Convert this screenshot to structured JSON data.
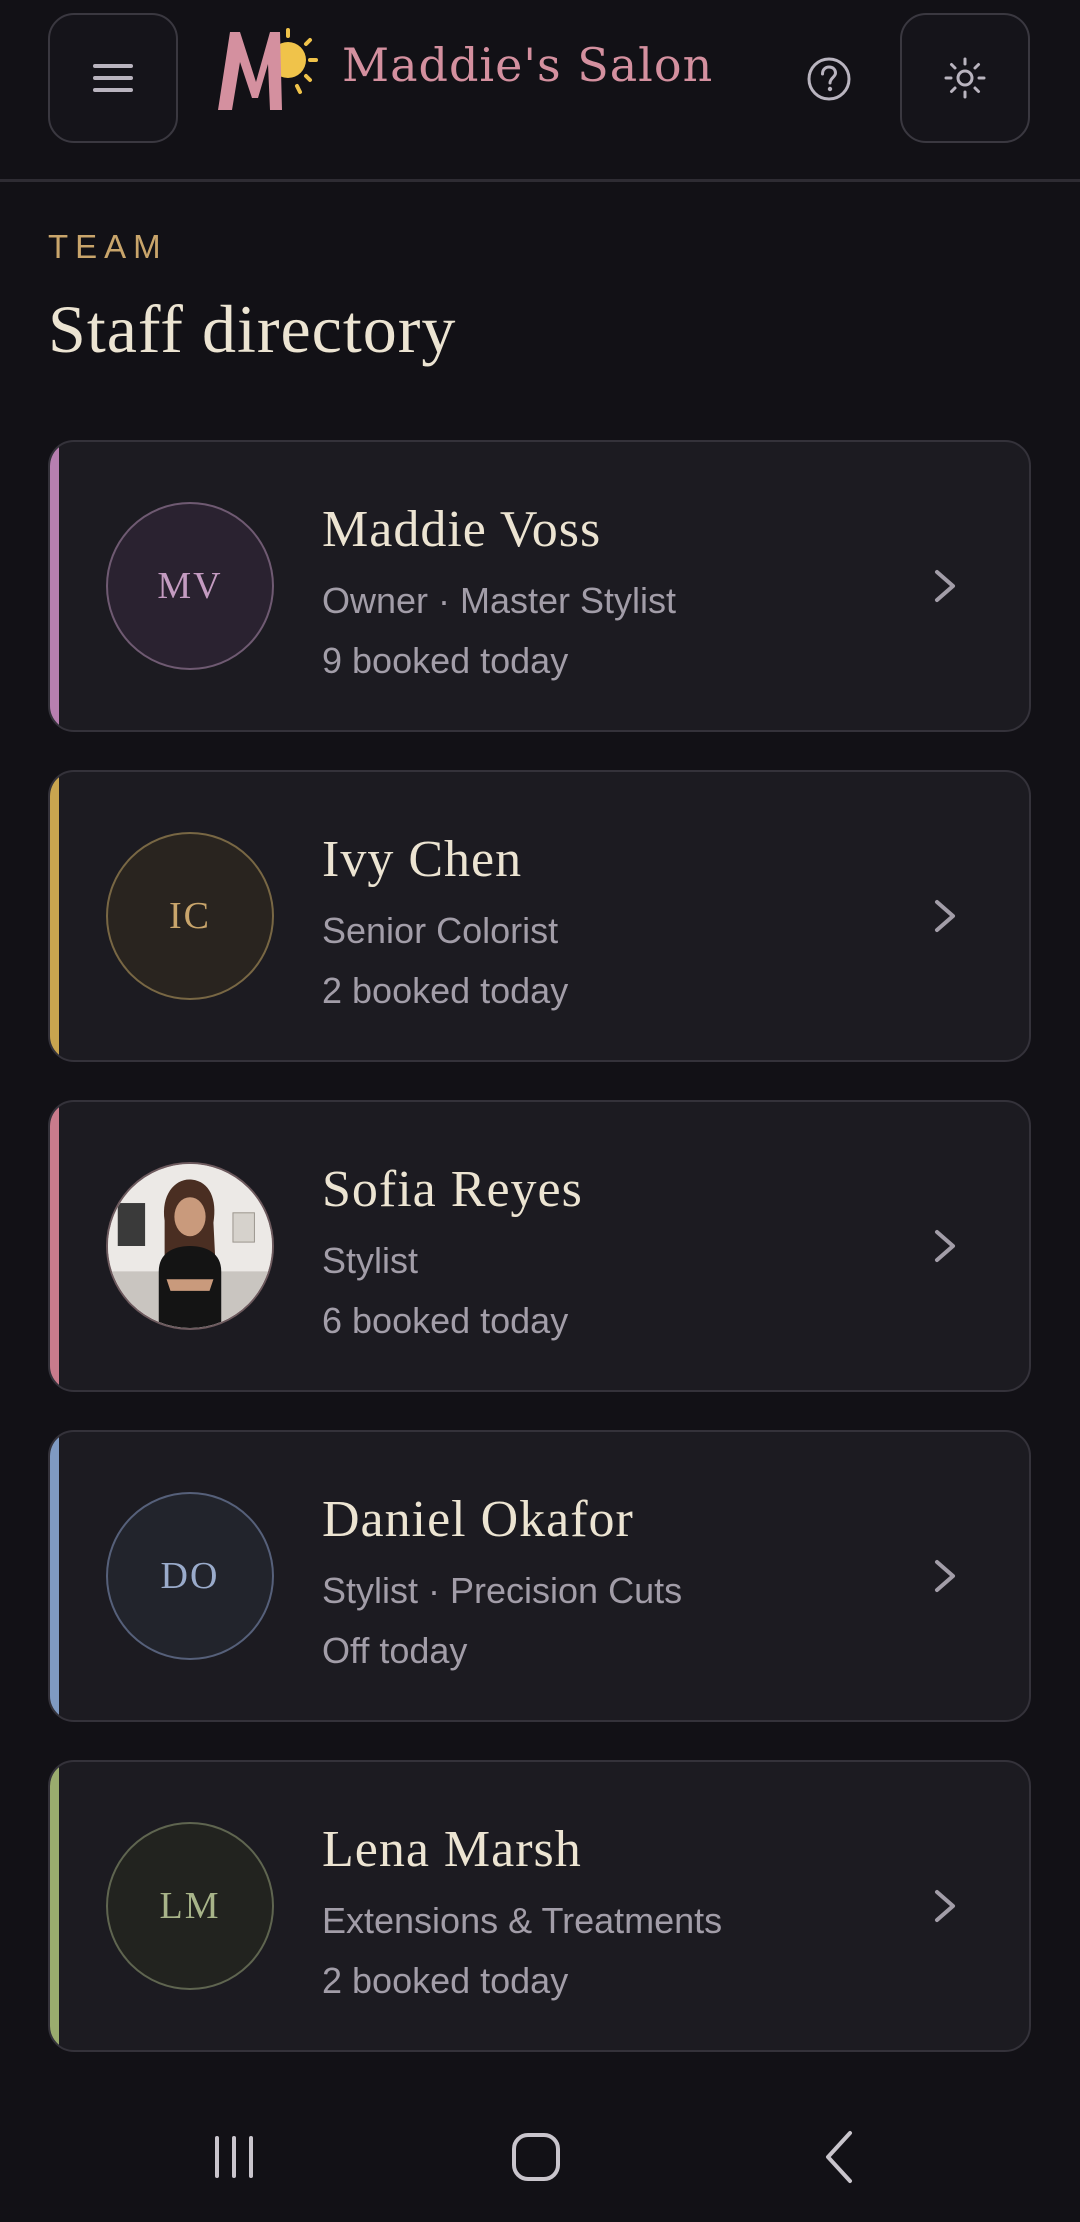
{
  "app": {
    "brand_name": "Maddie's Salon",
    "colors": {
      "background": "#121116",
      "card": "#1c1b21",
      "brand": "#d4909f",
      "gold": "#c9a56b"
    }
  },
  "header": {
    "menu_icon": "hamburger-menu-icon",
    "help_icon": "help-circle-icon",
    "theme_icon": "sun-icon"
  },
  "section": {
    "eyebrow": "TEAM",
    "title": "Staff directory"
  },
  "staff": [
    {
      "name": "Maddie Voss",
      "initials": "MV",
      "role": "Owner · Master Stylist",
      "status": "9 booked today",
      "accent": "#b77fb0",
      "avatar_bg": "#2a2230",
      "avatar_border": "#6f5a72",
      "avatar_text": "#c49bc1"
    },
    {
      "name": "Ivy Chen",
      "initials": "IC",
      "role": "Senior Colorist",
      "status": "2 booked today",
      "accent": "#c9a54f",
      "avatar_bg": "#29241f",
      "avatar_border": "#786744",
      "avatar_text": "#c9a56b"
    },
    {
      "name": "Sofia Reyes",
      "initials": "",
      "role": "Stylist",
      "status": "6 booked today",
      "accent": "#c97b8c",
      "avatar_bg": "#e8e6e4",
      "avatar_border": "#6d5a5e",
      "avatar_text": "#ffffff",
      "photo": true
    },
    {
      "name": "Daniel Okafor",
      "initials": "DO",
      "role": "Stylist · Precision Cuts",
      "status": "Off today",
      "accent": "#7f9ac2",
      "avatar_bg": "#22242c",
      "avatar_border": "#56607a",
      "avatar_text": "#9aabcb"
    },
    {
      "name": "Lena Marsh",
      "initials": "LM",
      "role": "Extensions & Treatments",
      "status": "2 booked today",
      "accent": "#9aac6e",
      "avatar_bg": "#22231f",
      "avatar_border": "#5f6550",
      "avatar_text": "#a8b489"
    }
  ],
  "navbar": {
    "recents_icon": "recents-icon",
    "home_icon": "home-icon",
    "back_icon": "back-icon"
  }
}
